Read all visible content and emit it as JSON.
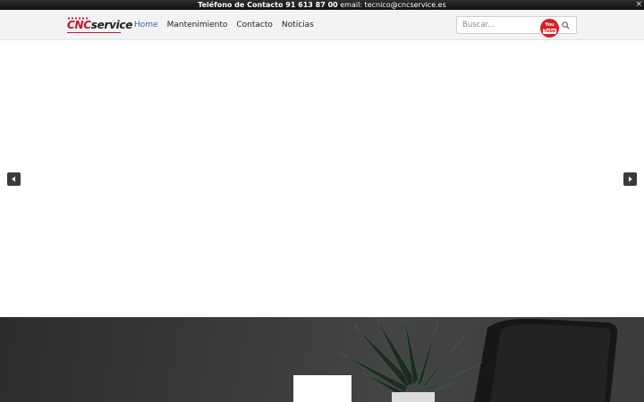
{
  "topbar": {
    "phone_label": "Teléfono de Contacto 91 613 87 00",
    "email_text": "email: tecnico@cncservice.es",
    "close_glyph": "×"
  },
  "logo": {
    "part1": "CNC",
    "part2": "service"
  },
  "nav": {
    "items": [
      {
        "label": "Home",
        "active": true
      },
      {
        "label": "Mantenimiento"
      },
      {
        "label": "Contacto"
      },
      {
        "label": "Noticias"
      }
    ]
  },
  "search": {
    "placeholder": "Buscar..."
  },
  "youtube": {
    "line1": "You",
    "line2": "Tube"
  },
  "colors": {
    "brand_red": "#c8102e",
    "nav_active": "#3a64a8",
    "topbar_bg": "#1a1a1a"
  }
}
